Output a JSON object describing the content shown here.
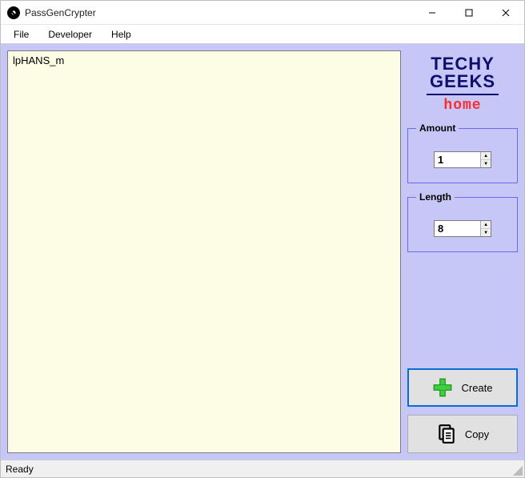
{
  "window": {
    "title": "PassGenCrypter"
  },
  "menu": {
    "file": "File",
    "developer": "Developer",
    "help": "Help"
  },
  "output": {
    "value": "lpHANS_m"
  },
  "logo": {
    "line1": "TECHY",
    "line2": "GEEKS",
    "line3": "home"
  },
  "amount": {
    "label": "Amount",
    "value": "1"
  },
  "length": {
    "label": "Length",
    "value": "8"
  },
  "buttons": {
    "create": "Create",
    "copy": "Copy"
  },
  "status": {
    "text": "Ready"
  }
}
